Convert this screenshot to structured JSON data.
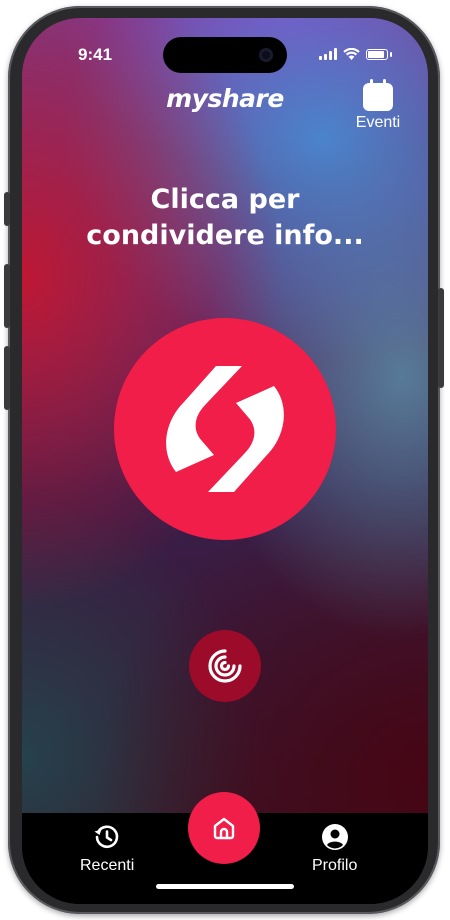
{
  "status_bar": {
    "time": "9:41"
  },
  "header": {
    "logo": "myshare",
    "events_label": "Eventi"
  },
  "main": {
    "headline_line1": "Clicca per",
    "headline_line2": "condividere info..."
  },
  "tabbar": {
    "recent_label": "Recenti",
    "profile_label": "Profilo"
  },
  "colors": {
    "accent": "#f01e48",
    "accent_dark": "#9c0b29",
    "tabbar_bg": "#000000"
  },
  "icons": {
    "events": "calendar-icon",
    "share": "share-logo-icon",
    "nfc": "nfc-signal-icon",
    "recent": "history-icon",
    "home": "home-icon",
    "profile": "user-circle-icon"
  }
}
